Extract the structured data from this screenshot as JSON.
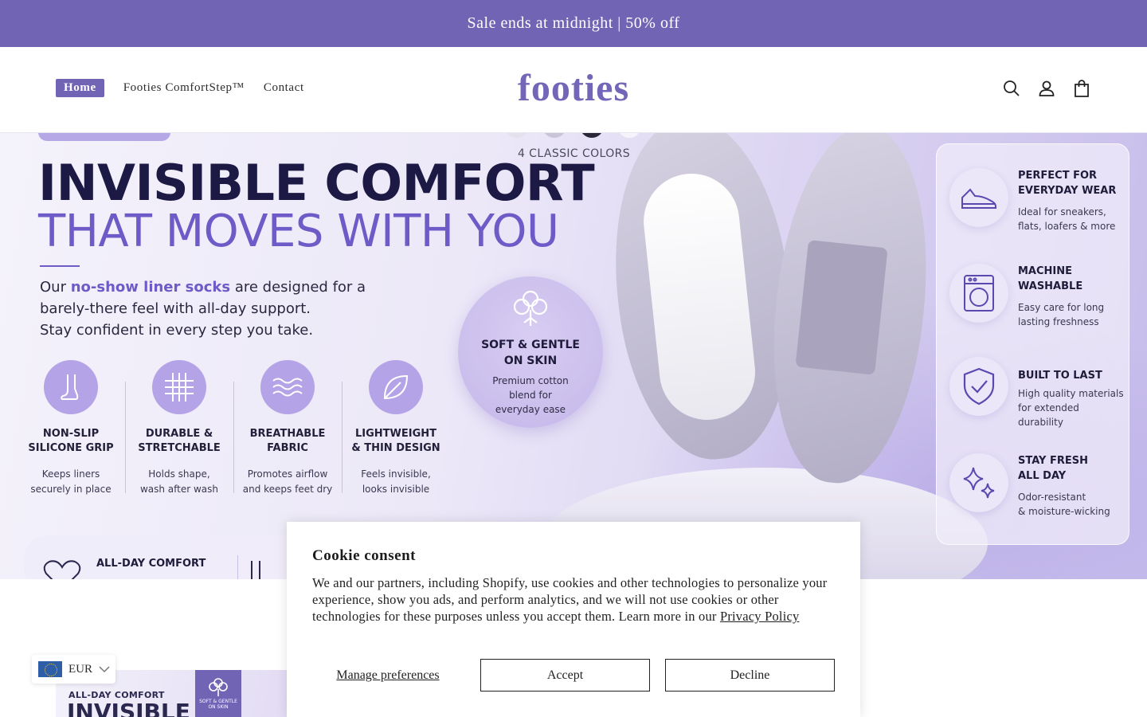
{
  "announcement": "Sale ends at midnight | 50% off",
  "nav": {
    "items": [
      {
        "label": "Home"
      },
      {
        "label": "Footies ComfortStep™"
      },
      {
        "label": "Contact"
      }
    ]
  },
  "brand": {
    "logo_text": "footies",
    "color": "#7366b8"
  },
  "colors": {
    "accent": "#7164b4",
    "hero_purple": "#6e5bc8"
  },
  "hero": {
    "colors_label": "4 CLASSIC COLORS",
    "title_line1": "INVISIBLE COMFORT",
    "title_line2": "THAT MOVES WITH YOU",
    "desc_prefix": "Our ",
    "desc_highlight": "no-show liner socks",
    "desc_line1_rest": " are designed for a",
    "desc_line2": "barely-there feel with all-day support.",
    "desc_line3": "Stay confident in every step you take.",
    "features": [
      {
        "icon": "foot-icon",
        "title1": "NON-SLIP",
        "title2": "SILICONE GRIP",
        "desc1": "Keeps liners",
        "desc2": "securely in place"
      },
      {
        "icon": "mesh-icon",
        "title1": "DURABLE &",
        "title2": "STRETCHABLE",
        "desc1": "Holds shape,",
        "desc2": "wash after wash"
      },
      {
        "icon": "waves-icon",
        "title1": "BREATHABLE",
        "title2": "FABRIC",
        "desc1": "Promotes airflow",
        "desc2": "and keeps feet dry"
      },
      {
        "icon": "leaf-icon",
        "title1": "LIGHTWEIGHT",
        "title2": "& THIN DESIGN",
        "desc1": "Feels invisible,",
        "desc2": "looks invisible"
      }
    ],
    "soft": {
      "title1": "SOFT & GENTLE",
      "title2": "ON SKIN",
      "desc1": "Premium cotton",
      "desc2": "blend for",
      "desc3": "everyday ease"
    },
    "panel": [
      {
        "icon": "sneaker-icon",
        "title1": "PERFECT FOR",
        "title2": "EVERYDAY WEAR",
        "desc1": "Ideal for sneakers,",
        "desc2": "flats, loafers & more"
      },
      {
        "icon": "washing-machine-icon",
        "title1": "MACHINE",
        "title2": "WASHABLE",
        "desc1": "Easy care for long",
        "desc2": "lasting freshness"
      },
      {
        "icon": "shield-check-icon",
        "title1": "BUILT TO LAST",
        "title2": "",
        "desc1": "High quality materials",
        "desc2": "for extended durability"
      },
      {
        "icon": "sparkle-icon",
        "title1": "STAY FRESH",
        "title2": "ALL DAY",
        "desc1": "Odor-resistant",
        "desc2": "& moisture-wicking"
      }
    ],
    "bottom_label": "ALL-DAY COMFORT"
  },
  "thumbnail": {
    "line1": "ALL-DAY COMFORT",
    "line2": "INVISIBLE",
    "badge1": "SOFT & GENTLE",
    "badge2": "ON SKIN"
  },
  "currency": {
    "code": "EUR"
  },
  "cookie": {
    "title": "Cookie consent",
    "body": "We and our partners, including Shopify, use cookies and other technologies to personalize your experience, show you ads, and perform analytics, and we will not use cookies or other technologies for these purposes unless you accept them. Learn more in our ",
    "link": "Privacy Policy",
    "manage": "Manage preferences",
    "accept": "Accept",
    "decline": "Decline"
  }
}
